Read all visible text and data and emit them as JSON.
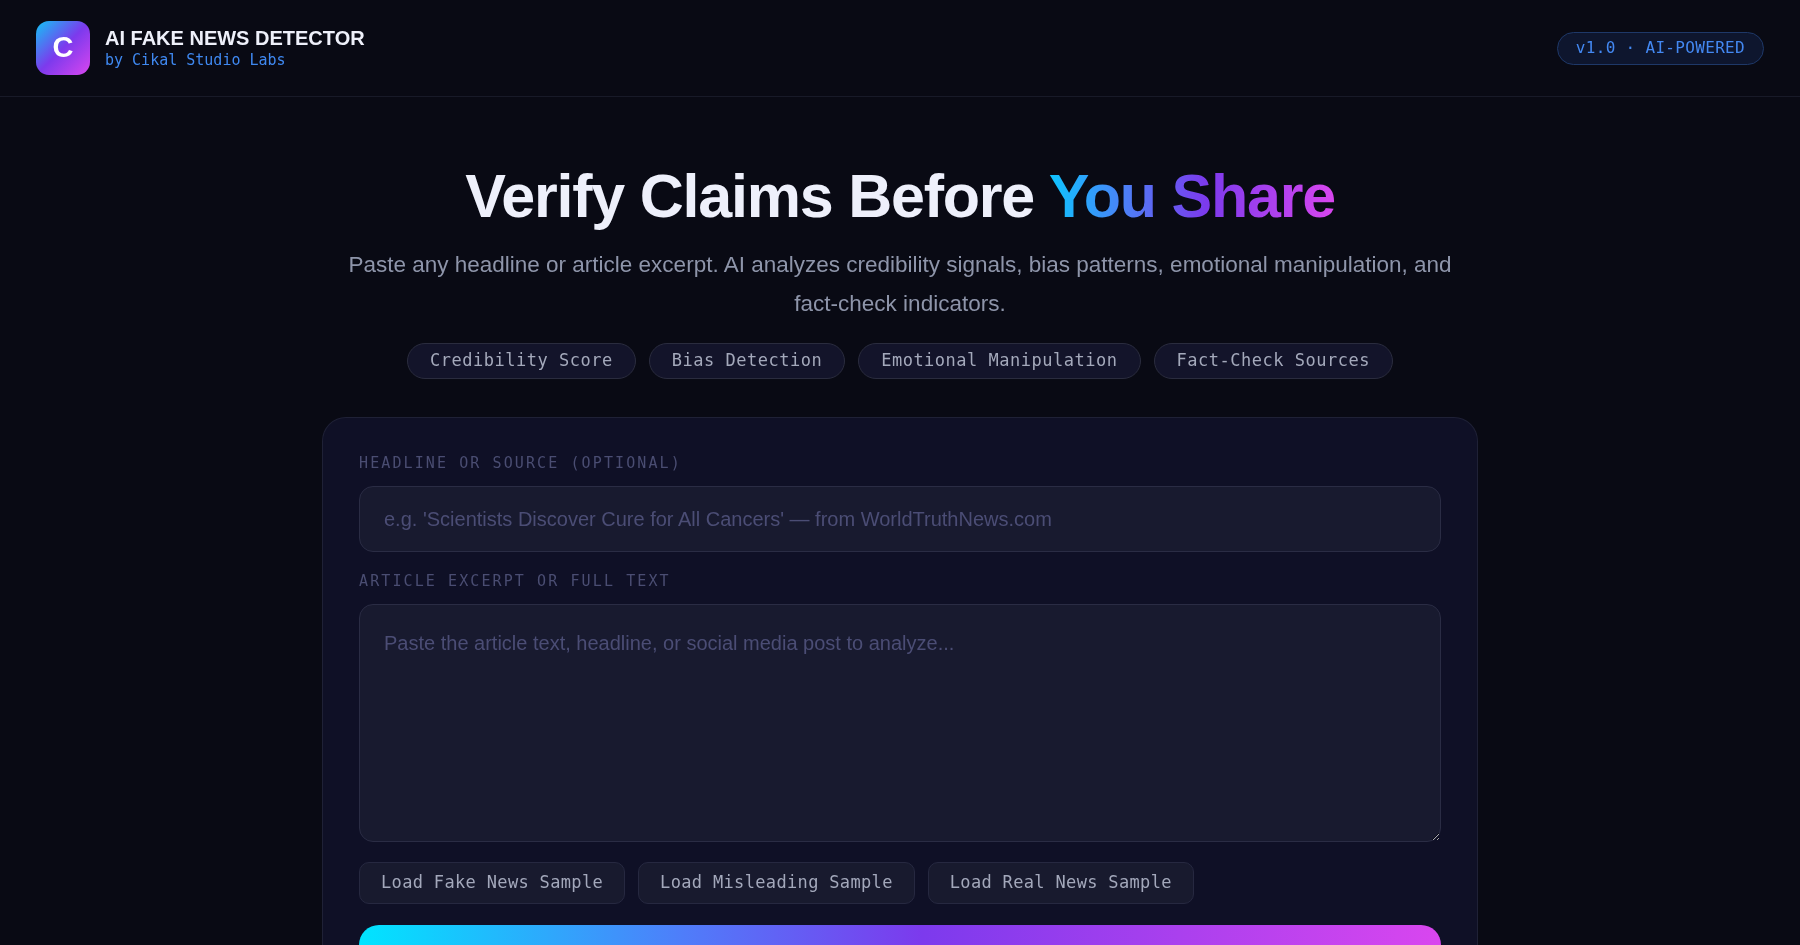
{
  "header": {
    "logo_letter": "C",
    "title": "AI FAKE NEWS DETECTOR",
    "subtitle": "by Cikal Studio Labs",
    "badge": "v1.0 · AI-POWERED"
  },
  "hero": {
    "title": "Verify Claims Before",
    "title_highlight": "You Share",
    "description": "Paste any headline or article excerpt. AI analyzes credibility signals, bias patterns, emotional manipulation, and fact-check indicators.",
    "features": [
      "Credibility Score",
      "Bias Detection",
      "Emotional Manipulation",
      "Fact-Check Sources"
    ]
  },
  "form": {
    "fields": [
      {
        "kind": "input",
        "label": "HEADLINE OR SOURCE (OPTIONAL)",
        "placeholder": "e.g. 'Scientists Discover Cure for All Cancers' — from WorldTruthNews.com"
      },
      {
        "kind": "textarea",
        "label": "ARTICLE EXCERPT OR FULL TEXT",
        "placeholder": "Paste the article text, headline, or social media post to analyze..."
      }
    ],
    "sample_buttons": [
      "Load Fake News Sample",
      "Load Misleading Sample",
      "Load Real News Sample"
    ]
  }
}
